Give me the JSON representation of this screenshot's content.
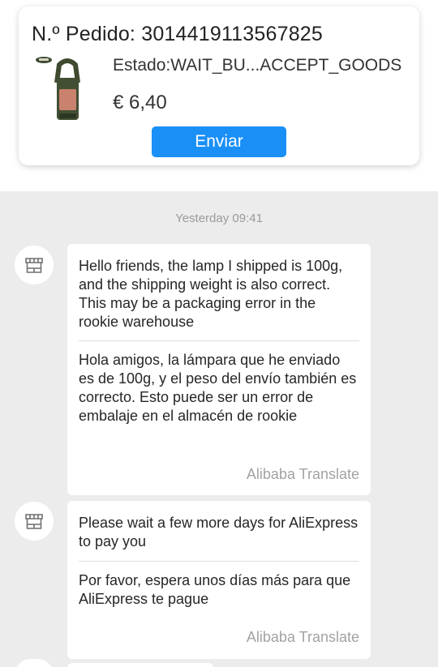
{
  "order": {
    "number": "N.º Pedido: 3014419113567825",
    "status": "Estado:WAIT_BU...ACCEPT_GOODS",
    "price": "€ 6,40",
    "send_label": "Enviar"
  },
  "chat": {
    "timestamp": "Yesterday 09:41",
    "messages": [
      {
        "original": "Hello friends, the lamp I shipped is 100g, and the shipping weight is also correct. This may be a packaging error in the rookie warehouse",
        "translation": "Hola amigos, la lámpara que he enviado es de 100g, y el peso del envío también es correcto. Esto puede ser un error de embalaje en el almacén de rookie",
        "credit": "Alibaba Translate"
      },
      {
        "original": "Please wait a few more days for AliExpress to pay you",
        "translation": "Por favor, espera unos días más para que AliExpress te pague",
        "credit": "Alibaba Translate"
      }
    ]
  },
  "icons": {
    "seller_avatar": "store-icon",
    "product": "product-thumbnail"
  },
  "colors": {
    "accent": "#1a8ff6",
    "chat_background": "#ececec"
  }
}
